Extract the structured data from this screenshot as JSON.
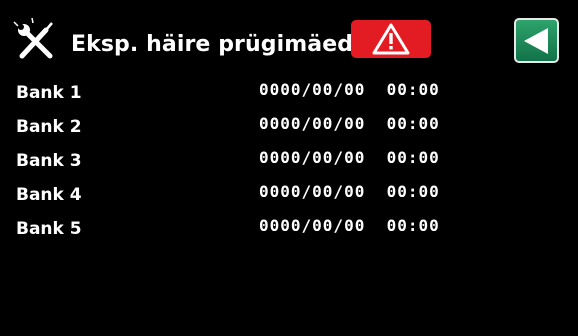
{
  "header": {
    "title": "Eksp. häire prügimäed",
    "tools_icon": "tools-icon",
    "alarm_icon": "warning-triangle-icon",
    "back_icon": "back-arrow-icon",
    "colors": {
      "alarm": "#e31b23",
      "back": "#2ea36b"
    }
  },
  "banks": [
    {
      "label": "Bank 1",
      "timestamp": "0000/00/00  00:00"
    },
    {
      "label": "Bank 2",
      "timestamp": "0000/00/00  00:00"
    },
    {
      "label": "Bank 3",
      "timestamp": "0000/00/00  00:00"
    },
    {
      "label": "Bank 4",
      "timestamp": "0000/00/00  00:00"
    },
    {
      "label": "Bank 5",
      "timestamp": "0000/00/00  00:00"
    }
  ]
}
